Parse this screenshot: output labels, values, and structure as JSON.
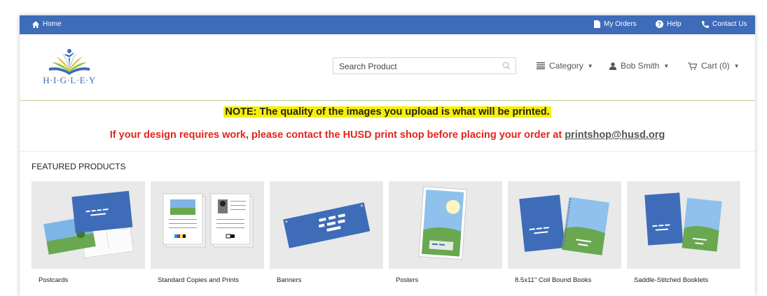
{
  "topbar": {
    "home": "Home",
    "my_orders": "My Orders",
    "help": "Help",
    "contact": "Contact Us"
  },
  "brand": {
    "name": "H·I·G·L·E·Y"
  },
  "search": {
    "placeholder": "Search Product"
  },
  "nav": {
    "category": "Category",
    "user": "Bob Smith",
    "cart": "Cart (0)"
  },
  "notice": {
    "note": "NOTE: The quality of the images you upload is what will be printed.",
    "warning": "If your design requires work, please contact the HUSD print shop before placing your order at",
    "email": "printshop@husd.org"
  },
  "featured": {
    "title": "FEATURED PRODUCTS",
    "products": [
      {
        "name": "Postcards",
        "icon": "postcard-icon"
      },
      {
        "name": "Standard Copies and Prints",
        "icon": "copies-icon"
      },
      {
        "name": "Banners",
        "icon": "banner-icon"
      },
      {
        "name": "Posters",
        "icon": "poster-icon"
      },
      {
        "name": "8.5x11\" Coil Bound Books",
        "icon": "coil-book-icon"
      },
      {
        "name": "Saddle-Stitched Booklets",
        "icon": "booklet-icon"
      }
    ]
  },
  "colors": {
    "topbar": "#3e6cb8",
    "warning": "#e1261c",
    "highlight": "#f7f000",
    "divider": "#b8d69a"
  }
}
